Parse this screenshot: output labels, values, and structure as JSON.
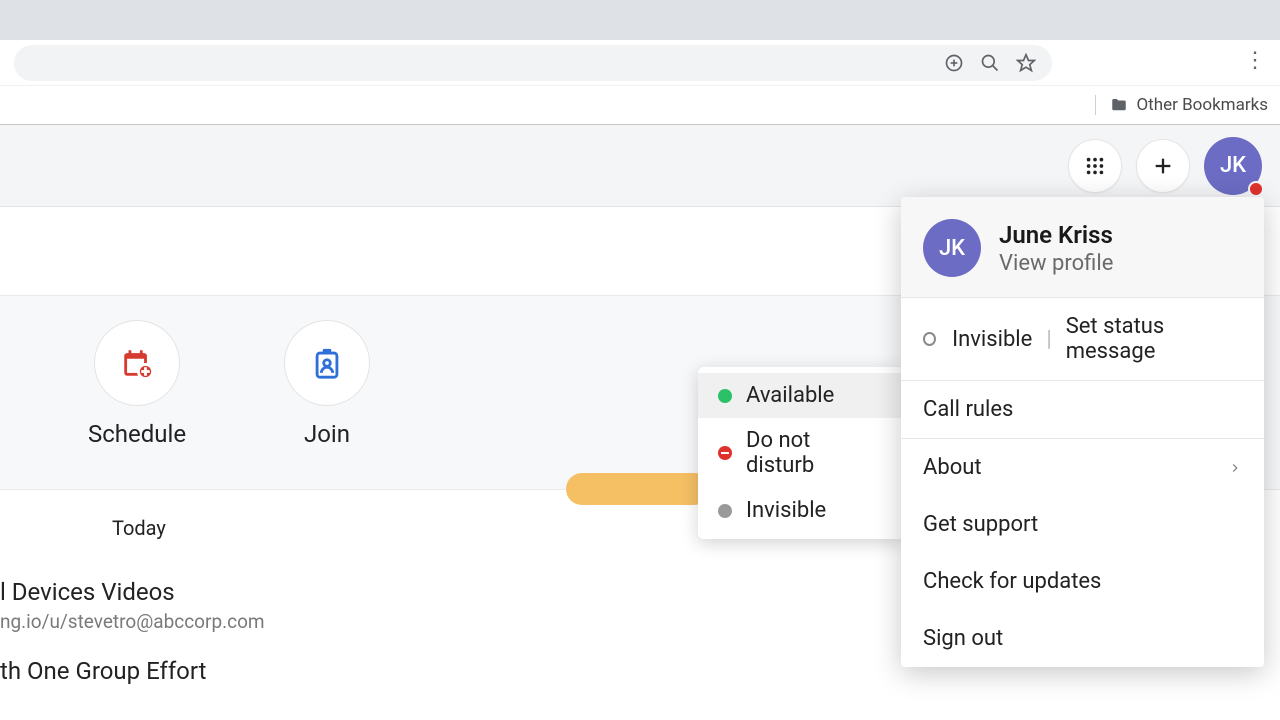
{
  "browser": {
    "bookmarks_label": "Other Bookmarks"
  },
  "avatar_initials": "JK",
  "profile": {
    "name": "June Kriss",
    "view_profile": "View profile",
    "status_label": "Invisible",
    "set_status_link": "Set status message",
    "call_rules": "Call rules",
    "about": "About",
    "get_support": "Get support",
    "check_updates": "Check for updates",
    "sign_out": "Sign out"
  },
  "status_options": {
    "available": "Available",
    "dnd": "Do not disturb",
    "invisible": "Invisible"
  },
  "actions": {
    "schedule": "Schedule",
    "join": "Join"
  },
  "today_label": "Today",
  "list": [
    {
      "title": "l Devices Videos",
      "sub": "ng.io/u/stevetro@abccorp.com"
    },
    {
      "title": "th One Group Effort"
    }
  ]
}
